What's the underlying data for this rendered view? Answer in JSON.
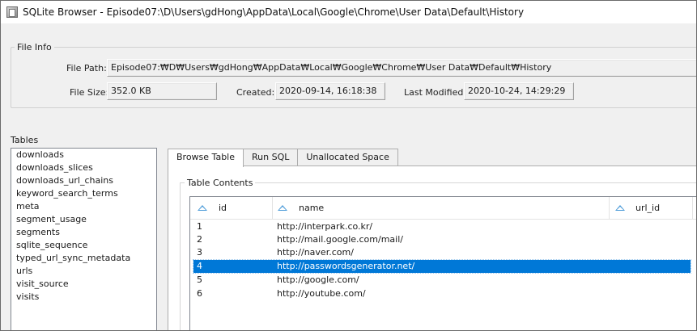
{
  "window": {
    "title": "SQLite Browser - Episode07:\\D\\Users\\gdHong\\AppData\\Local\\Google\\Chrome\\User Data\\Default\\History"
  },
  "file_info": {
    "group_label": "File Info",
    "path_label": "File Path:",
    "path_value": "Episode07:₩D₩Users₩gdHong₩AppData₩Local₩Google₩Chrome₩User Data₩Default₩History",
    "size_label": "File Size:",
    "size_value": "352.0 KB",
    "created_label": "Created:",
    "created_value": "2020-09-14, 16:18:38",
    "modified_label": "Last Modified:",
    "modified_value": "2020-10-24, 14:29:29"
  },
  "tables": {
    "label": "Tables",
    "items": [
      "downloads",
      "downloads_slices",
      "downloads_url_chains",
      "keyword_search_terms",
      "meta",
      "segment_usage",
      "segments",
      "sqlite_sequence",
      "typed_url_sync_metadata",
      "urls",
      "visit_source",
      "visits"
    ]
  },
  "tabs": [
    {
      "label": "Browse Table",
      "active": true
    },
    {
      "label": "Run SQL",
      "active": false
    },
    {
      "label": "Unallocated Space",
      "active": false
    }
  ],
  "table_contents": {
    "label": "Table Contents",
    "columns": [
      "id",
      "name",
      "url_id"
    ],
    "rows": [
      {
        "id": "1",
        "name": "http://interpark.co.kr/",
        "url_id": ""
      },
      {
        "id": "2",
        "name": "http://mail.google.com/mail/",
        "url_id": ""
      },
      {
        "id": "3",
        "name": "http://naver.com/",
        "url_id": ""
      },
      {
        "id": "4",
        "name": "http://passwordsgenerator.net/",
        "url_id": "",
        "selected": true
      },
      {
        "id": "5",
        "name": "http://google.com/",
        "url_id": ""
      },
      {
        "id": "6",
        "name": "http://youtube.com/",
        "url_id": ""
      }
    ]
  },
  "colors": {
    "selection": "#0078d7",
    "sort_icon": "#4a9ad8"
  }
}
